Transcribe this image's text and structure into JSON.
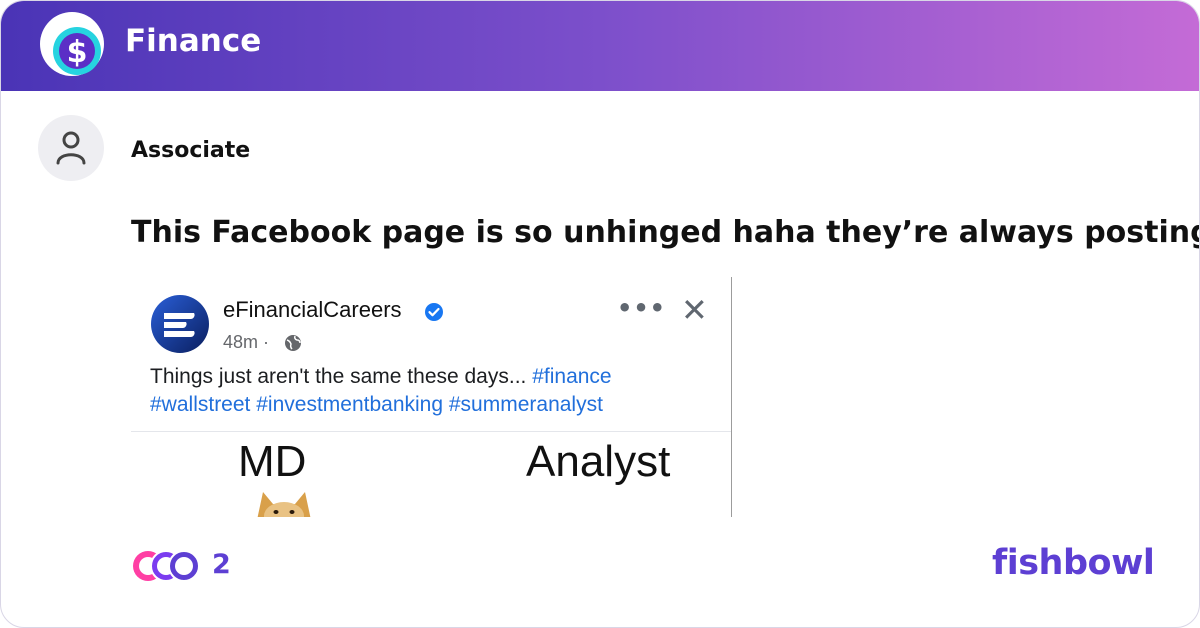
{
  "channel": {
    "name": "Finance",
    "icon": "dollar-coin-icon"
  },
  "author": {
    "name": "Associate",
    "avatar_icon": "user-icon"
  },
  "post": {
    "title": "This Facebook page is so unhinged haha they’re always posting...",
    "image": {
      "page_name": "eFinancialCareers",
      "time": "48m",
      "time_separator": " · ",
      "more_label": "•••",
      "close_label": "✕",
      "caption_text": "Things just aren't the same these days... ",
      "hashtags": [
        "#finance",
        "#wallstreet",
        "#investmentbanking",
        "#summeranalyst"
      ],
      "meme_left_label": "MD",
      "meme_right_label": "Analyst"
    }
  },
  "footer": {
    "reaction_count": "2",
    "brand": "fishbowl"
  },
  "colors": {
    "header_start": "#4a34b6",
    "header_end": "#c46bd6",
    "accent": "#5d3fd3",
    "link": "#216fdb"
  }
}
